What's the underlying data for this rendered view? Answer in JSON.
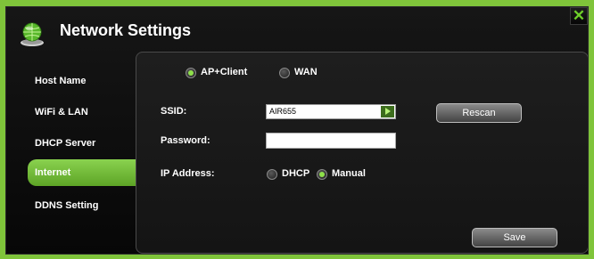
{
  "window": {
    "title": "Network Settings",
    "close_icon": "close-x-icon"
  },
  "colors": {
    "accent_green": "#6cb832",
    "background_green": "#7fc43a"
  },
  "sidebar": {
    "items": [
      {
        "label": "Host Name",
        "active": false
      },
      {
        "label": "WiFi & LAN",
        "active": false
      },
      {
        "label": "DHCP Server",
        "active": false
      },
      {
        "label": "Internet",
        "active": true
      },
      {
        "label": "DDNS Setting",
        "active": false
      }
    ]
  },
  "mode": {
    "options": [
      {
        "label": "AP+Client",
        "checked": true
      },
      {
        "label": "WAN",
        "checked": false
      }
    ]
  },
  "form": {
    "ssid_label": "SSID:",
    "ssid_value": "AIR655",
    "password_label": "Password:",
    "password_value": "",
    "ip_label": "IP Address:",
    "ip_options": [
      {
        "label": "DHCP",
        "checked": false
      },
      {
        "label": "Manual",
        "checked": true
      }
    ]
  },
  "buttons": {
    "rescan": "Rescan",
    "save": "Save"
  }
}
